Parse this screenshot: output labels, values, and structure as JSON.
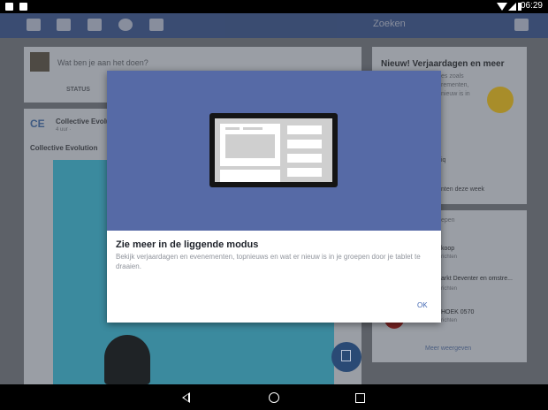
{
  "status_bar": {
    "time": "06:29"
  },
  "topbar": {
    "search_placeholder": "Zoeken"
  },
  "composer": {
    "placeholder": "Wat ben je aan het doen?",
    "status_label": "STATUS"
  },
  "post": {
    "page_name": "Collective Evolu",
    "time": "4 uur · ",
    "title": "Collective Evolution",
    "logo_text": "CE"
  },
  "right_column": {
    "title": "Nieuw! Verjaardagen en meer",
    "sub1": "es zoals",
    "sub2": "rementen,",
    "sub3": "nieuw is in",
    "line1": "iq",
    "line2": "nten deze week"
  },
  "groups": {
    "header": "epen",
    "items": [
      {
        "name": "koop",
        "meta": "richten"
      },
      {
        "name": "arkt Deventer en omstre...",
        "meta": "richten"
      },
      {
        "name": "HOEK 0570",
        "meta": "richten"
      }
    ],
    "more": "Meer weergeven"
  },
  "dialog": {
    "title": "Zie meer in de liggende modus",
    "body": "Bekijk verjaardagen en evenementen, topnieuws en wat er nieuw is in je groepen door je tablet te draaien.",
    "ok_label": "OK"
  },
  "colors": {
    "facebook_blue": "#3b5998",
    "dialog_hero": "#566aa6",
    "link": "#4267b2"
  }
}
